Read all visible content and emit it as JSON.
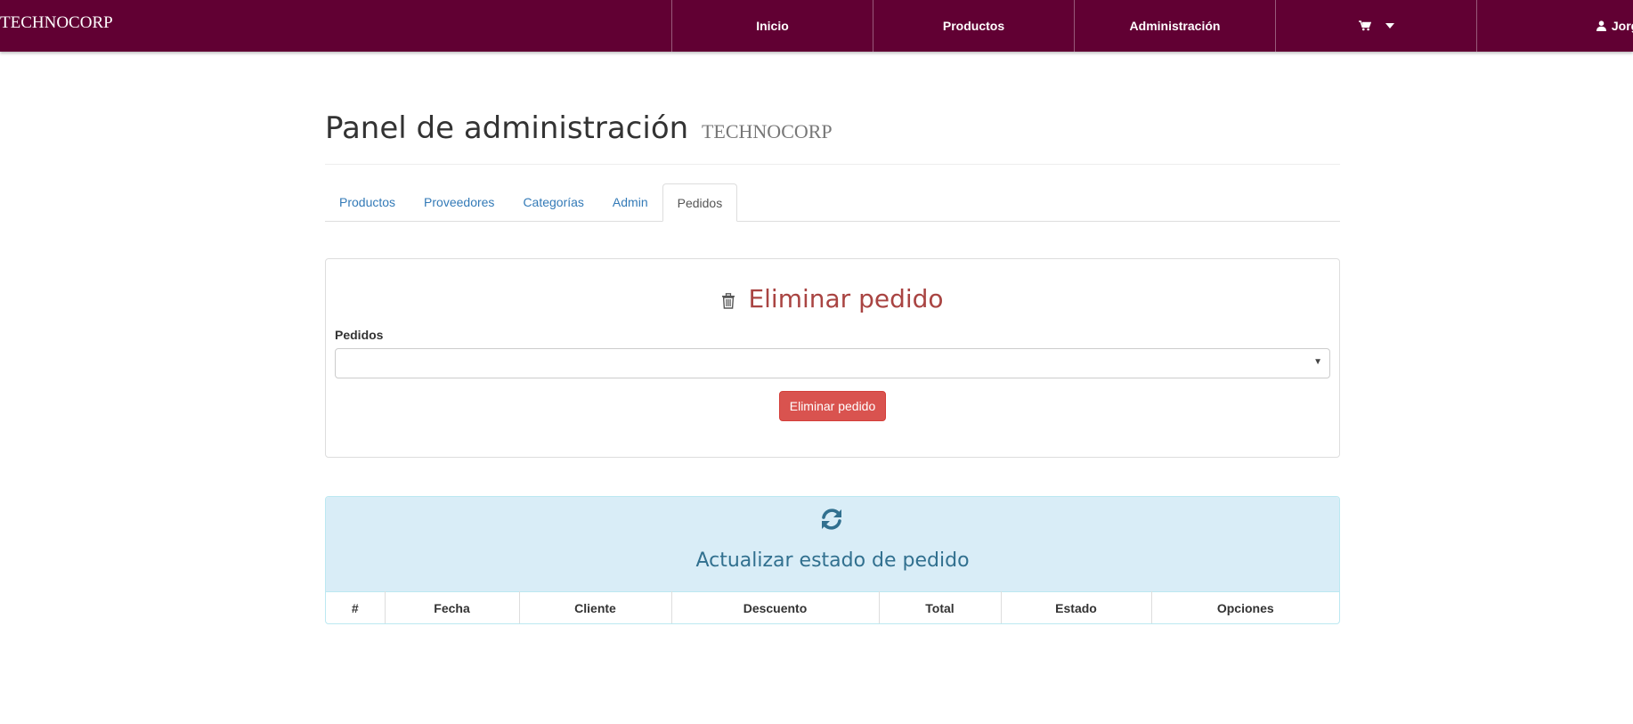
{
  "navbar": {
    "brand": "TECHNOCORP",
    "items": [
      {
        "label": "Inicio"
      },
      {
        "label": "Productos"
      },
      {
        "label": "Administración"
      },
      {
        "label": "",
        "icon": "shopping-cart-icon"
      },
      {
        "label": "Jorge",
        "icon": "user-icon"
      }
    ],
    "background": "#610033"
  },
  "header": {
    "title": "Panel de administración",
    "subtitle": "TECHNOCORP"
  },
  "tabs": [
    {
      "label": "Productos",
      "active": false
    },
    {
      "label": "Proveedores",
      "active": false
    },
    {
      "label": "Categorías",
      "active": false
    },
    {
      "label": "Admin",
      "active": false
    },
    {
      "label": "Pedidos",
      "active": true
    }
  ],
  "delete_panel": {
    "title": "Eliminar pedido",
    "icon": "trash-icon",
    "field_label": "Pedidos",
    "select_value": "",
    "button_label": "Eliminar pedido",
    "button_color": "#d9534f",
    "title_color": "#a94442"
  },
  "update_panel": {
    "icon": "refresh-icon",
    "title": "Actualizar estado de pedido",
    "heading_color": "#d9edf7",
    "columns": [
      "#",
      "Fecha",
      "Cliente",
      "Descuento",
      "Total",
      "Estado",
      "Opciones"
    ]
  }
}
